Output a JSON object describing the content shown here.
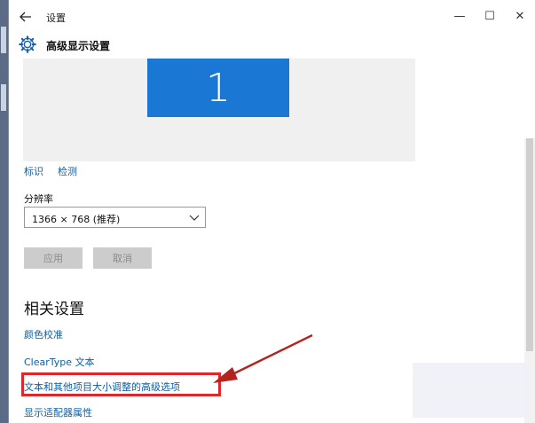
{
  "window": {
    "app_title": "设置",
    "controls": {
      "minimize": "—",
      "maximize": "☐",
      "close": "✕"
    }
  },
  "header": {
    "title": "高级显示设置"
  },
  "preview": {
    "monitor_number": "1"
  },
  "links": {
    "identify": "标识",
    "detect": "检测"
  },
  "resolution": {
    "label": "分辨率",
    "value": "1366 × 768 (推荐)"
  },
  "buttons": {
    "apply": "应用",
    "cancel": "取消"
  },
  "related": {
    "title": "相关设置",
    "items": [
      "颜色校准",
      "ClearType 文本",
      "文本和其他项目大小调整的高级选项",
      "显示适配器属性"
    ]
  },
  "colors": {
    "accent": "#0b5fa8",
    "monitor": "#1a78d4",
    "highlight": "#e0262b",
    "arrow": "#b3241f"
  }
}
